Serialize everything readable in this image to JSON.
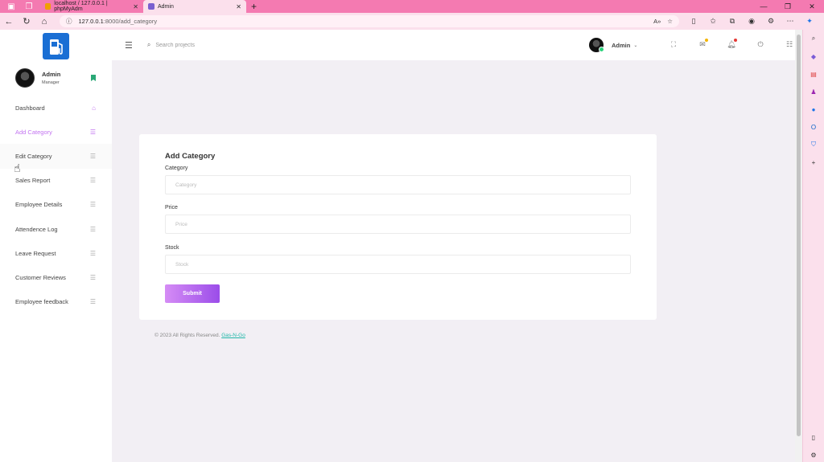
{
  "browser": {
    "tabs": [
      {
        "title": "localhost / 127.0.0.1 | phpMyAdm",
        "active": false
      },
      {
        "title": "Admin",
        "active": true
      }
    ],
    "url_host": "127.0.0.1",
    "url_path": ":8000/add_category"
  },
  "sidebar": {
    "profile": {
      "name": "Admin",
      "role": "Manager"
    },
    "items": [
      {
        "label": "Dashboard",
        "icon": "home-icon"
      },
      {
        "label": "Add Category",
        "icon": "list-icon"
      },
      {
        "label": "Edit Category",
        "icon": "list-icon"
      },
      {
        "label": "Sales Report",
        "icon": "list-icon"
      },
      {
        "label": "Employee Details",
        "icon": "list-icon"
      },
      {
        "label": "Attendence Log",
        "icon": "list-icon"
      },
      {
        "label": "Leave Request",
        "icon": "list-icon"
      },
      {
        "label": "Customer Reviews",
        "icon": "list-icon"
      },
      {
        "label": "Employee feedback",
        "icon": "list-icon"
      }
    ]
  },
  "topbar": {
    "search_placeholder": "Search projects",
    "user_name": "Admin"
  },
  "form": {
    "title": "Add Category",
    "fields": [
      {
        "label": "Category",
        "placeholder": "Category"
      },
      {
        "label": "Price",
        "placeholder": "Price"
      },
      {
        "label": "Stock",
        "placeholder": "Stock"
      }
    ],
    "submit_label": "Submit"
  },
  "footer": {
    "text": "© 2023 All Rights Reserved.",
    "link": "Gas-N-Go"
  },
  "colors": {
    "accent": "#c273f0",
    "browser_tab": "#f47ab1",
    "link": "#1fb7a8"
  }
}
